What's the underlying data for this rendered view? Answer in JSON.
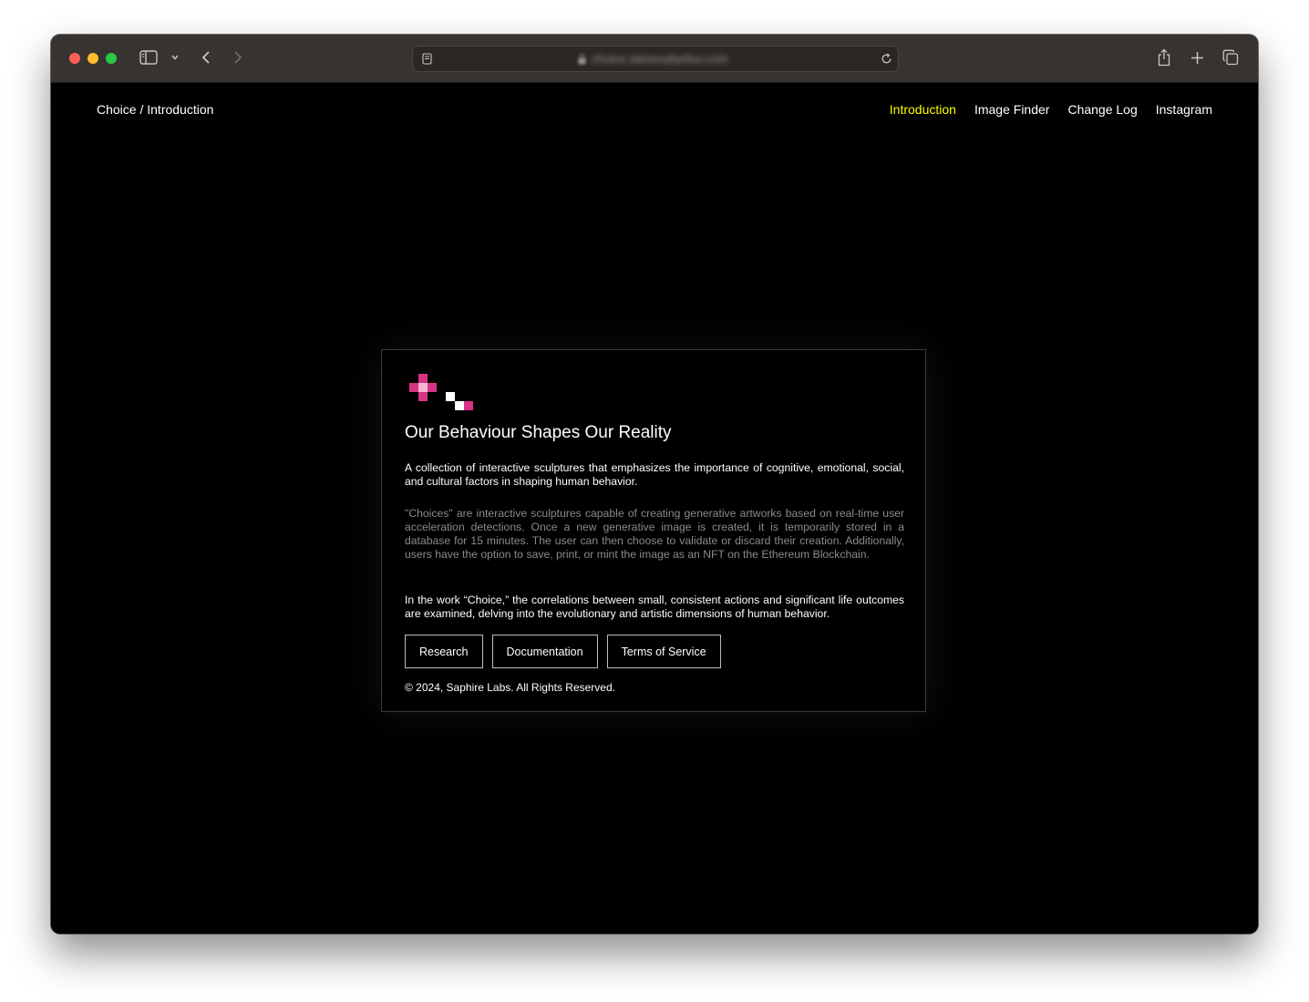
{
  "browser": {
    "url": "choice.stevesafarilou.com",
    "colors": {
      "close": "#fe5f57",
      "minimize": "#febc2e",
      "zoom": "#28c840",
      "toolbar": "#383331"
    },
    "icons": [
      "sidebar-icon",
      "chevron-down-icon",
      "back-icon",
      "forward-icon",
      "page-icon",
      "lock-icon",
      "reload-icon",
      "share-icon",
      "new-tab-icon",
      "tabs-overview-icon"
    ]
  },
  "header": {
    "site_title": "Choice / Introduction",
    "nav": [
      {
        "label": "Introduction",
        "active": true
      },
      {
        "label": "Image Finder",
        "active": false
      },
      {
        "label": "Change Log",
        "active": false
      },
      {
        "label": "Instagram",
        "active": false
      }
    ],
    "active_color": "#ffff00"
  },
  "card": {
    "logo_colors": {
      "pink": "#d63384",
      "light_pink": "#f4b6d2",
      "white": "#ffffff"
    },
    "title": "Our Behaviour Shapes Our Reality",
    "lead": "A collection of interactive sculptures that emphasizes the importance of cognitive, emotional, social, and cultural factors in shaping human behavior.",
    "description": "\"Choices\" are interactive sculptures capable of creating generative artworks based on real-time user acceleration detections. Once a new generative image is created, it is temporarily stored in a database for 15 minutes. The user can then choose to validate or discard their creation. Additionally, users have the option to save, print, or mint the image as an NFT on the Ethereum Blockchain.",
    "closing": "In the work “Choice,” the correlations between small, consistent actions and significant life outcomes are examined, delving into the evolutionary and artistic dimensions of human behavior.",
    "buttons": {
      "research": "Research",
      "documentation": "Documentation",
      "terms": "Terms of Service"
    },
    "copyright": "© 2024, Saphire Labs. All Rights Reserved."
  }
}
